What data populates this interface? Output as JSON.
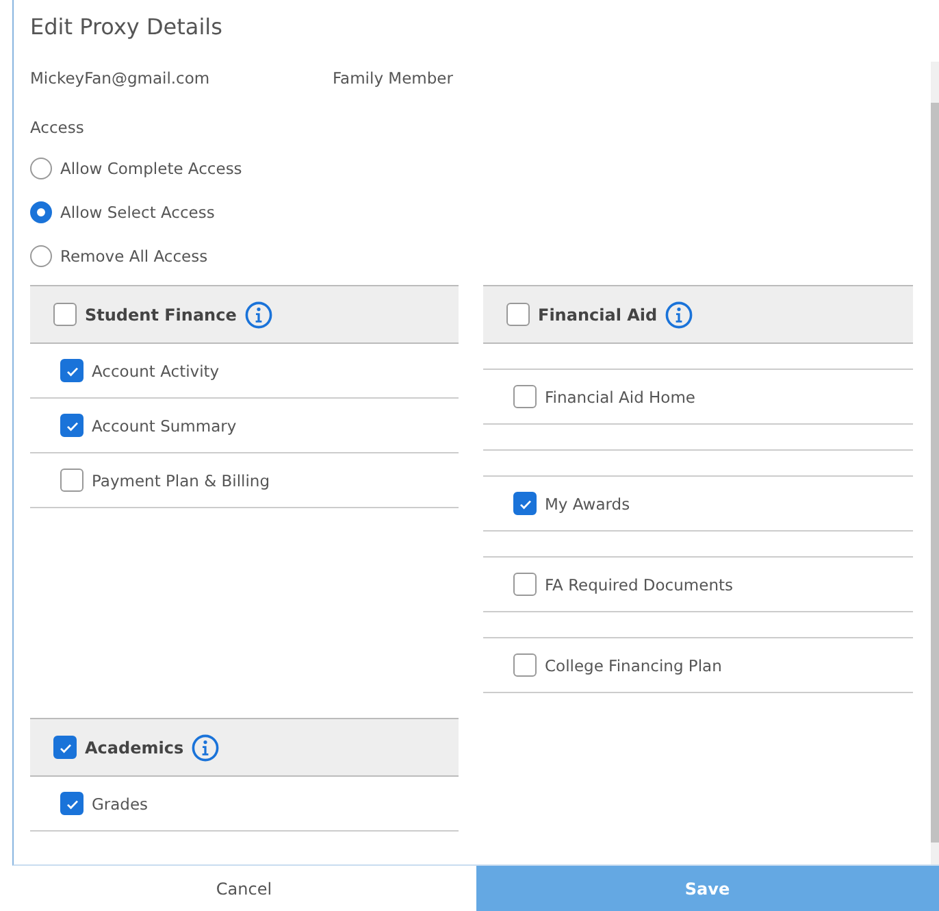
{
  "dialog": {
    "title": "Edit Proxy Details"
  },
  "proxy": {
    "email": "MickeyFan@gmail.com",
    "relationship": "Family Member"
  },
  "access": {
    "label": "Access",
    "options": [
      {
        "label": "Allow Complete Access",
        "selected": false
      },
      {
        "label": "Allow Select Access",
        "selected": true
      },
      {
        "label": "Remove All Access",
        "selected": false
      }
    ]
  },
  "columns": [
    {
      "sections": [
        {
          "title": "Student Finance",
          "checked": false,
          "items": [
            {
              "kind": "item",
              "label": "Account Activity",
              "checked": true
            },
            {
              "kind": "item",
              "label": "Account Summary",
              "checked": true
            },
            {
              "kind": "item",
              "label": "Payment Plan & Billing",
              "checked": false
            }
          ]
        },
        {
          "title": "Academics",
          "checked": true,
          "items": [
            {
              "kind": "item",
              "label": "Grades",
              "checked": true
            }
          ]
        }
      ]
    },
    {
      "sections": [
        {
          "title": "Financial Aid",
          "checked": false,
          "items": [
            {
              "kind": "blank"
            },
            {
              "kind": "item",
              "label": "Financial Aid Home",
              "checked": false
            },
            {
              "kind": "blank"
            },
            {
              "kind": "blank"
            },
            {
              "kind": "item",
              "label": "My Awards",
              "checked": true
            },
            {
              "kind": "blank"
            },
            {
              "kind": "item",
              "label": "FA Required Documents",
              "checked": false
            },
            {
              "kind": "blank"
            },
            {
              "kind": "item",
              "label": "College Financing Plan",
              "checked": false
            }
          ]
        }
      ]
    }
  ],
  "buttons": [
    {
      "label": "Cancel",
      "kind": "secondary"
    },
    {
      "label": "Save",
      "kind": "primary"
    }
  ]
}
